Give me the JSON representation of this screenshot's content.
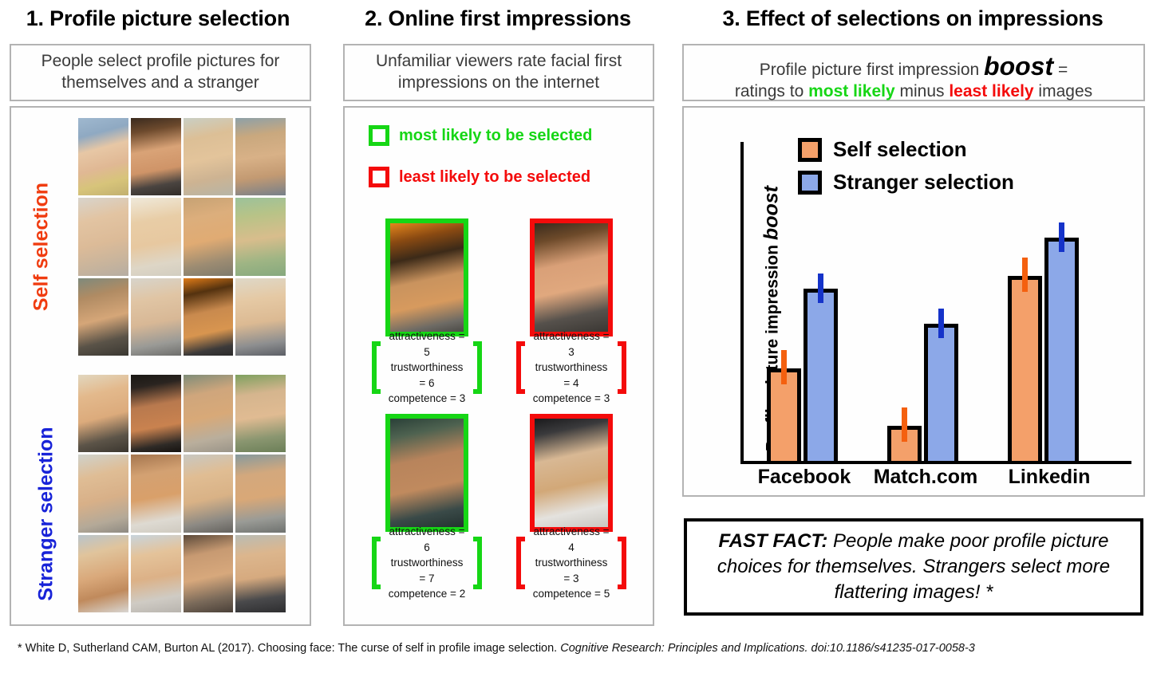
{
  "panels": [
    {
      "heading": "1. Profile picture selection",
      "caption": "People select profile pictures for themselves and a stranger",
      "groups": [
        {
          "label": "Self selection",
          "color": "#f03c10",
          "highlight_red": {
            "row": 1,
            "col": 2
          },
          "highlight_green": {
            "row": 3,
            "col": 3
          }
        },
        {
          "label": "Stranger selection",
          "color": "#1823d8",
          "highlight_green": {
            "row": 1,
            "col": 2
          },
          "highlight_red": {
            "row": 3,
            "col": 1
          }
        }
      ]
    },
    {
      "heading": "2. Online first impressions",
      "caption": "Unfamiliar viewers rate facial first impressions on the internet",
      "key": [
        {
          "label": "most likely to be selected",
          "color": "#16d615"
        },
        {
          "label": "least likely to be selected",
          "color": "#f40b0b"
        }
      ],
      "examples": [
        {
          "type": "green",
          "attractiveness": "attractiveness = 5",
          "trustworthiness": "trustworthiness = 6",
          "competence": "competence = 3"
        },
        {
          "type": "red",
          "attractiveness": "attractiveness = 3",
          "trustworthiness": "trustworthiness = 4",
          "competence": "competence = 3"
        },
        {
          "type": "green",
          "attractiveness": "attractiveness = 6",
          "trustworthiness": "trustworthiness = 7",
          "competence": "competence = 2"
        },
        {
          "type": "red",
          "attractiveness": "attractiveness = 4",
          "trustworthiness": "trustworthiness = 3",
          "competence": "competence = 5"
        }
      ]
    },
    {
      "heading": "3. Effect of selections on impressions",
      "caption_line1_a": "Profile picture first impression ",
      "caption_line1_boost": "boost",
      "caption_line1_b": " =",
      "caption_line2_a": "ratings to ",
      "caption_line2_most": "most likely",
      "caption_line2_b": " minus ",
      "caption_line2_least": "least likely",
      "caption_line2_c": " images"
    }
  ],
  "chart_data": {
    "type": "bar",
    "title": "",
    "ylabel_prefix": "Profile picture impression ",
    "ylabel_emphasis": "boost",
    "xlabel": "",
    "categories": [
      "Facebook",
      "Match.com",
      "Linkedin"
    ],
    "series": [
      {
        "name": "Self selection",
        "color": "#f4a06a",
        "error_color": "#f4600f",
        "values": [
          0.29,
          0.11,
          0.58
        ],
        "errors": [
          0.035,
          0.035,
          0.035
        ]
      },
      {
        "name": "Stranger selection",
        "color": "#8ca8e8",
        "error_color": "#1533c9",
        "values": [
          0.54,
          0.43,
          0.7
        ],
        "errors": [
          0.03,
          0.03,
          0.03
        ]
      }
    ],
    "ylim": [
      0,
      1.0
    ],
    "grid": false,
    "legend_position": "top-center",
    "axis_ticks_shown": false
  },
  "fast_fact": {
    "label": "FAST FACT:",
    "text": " People make poor profile picture choices for themselves. Strangers select more flattering images! *"
  },
  "footnote": {
    "part1": "* White D, Sutherland CAM, Burton AL (2017). Choosing face: The curse of self in profile image selection. ",
    "italic": "Cognitive Research: Principles and Implications. doi:10.1186/s41235-017-0058-3"
  },
  "colors": {
    "green": "#16d615",
    "red": "#f40b0b",
    "self_orange": "#f4a06a",
    "stranger_blue": "#8ca8e8",
    "panel_border": "#b3b3b3"
  }
}
